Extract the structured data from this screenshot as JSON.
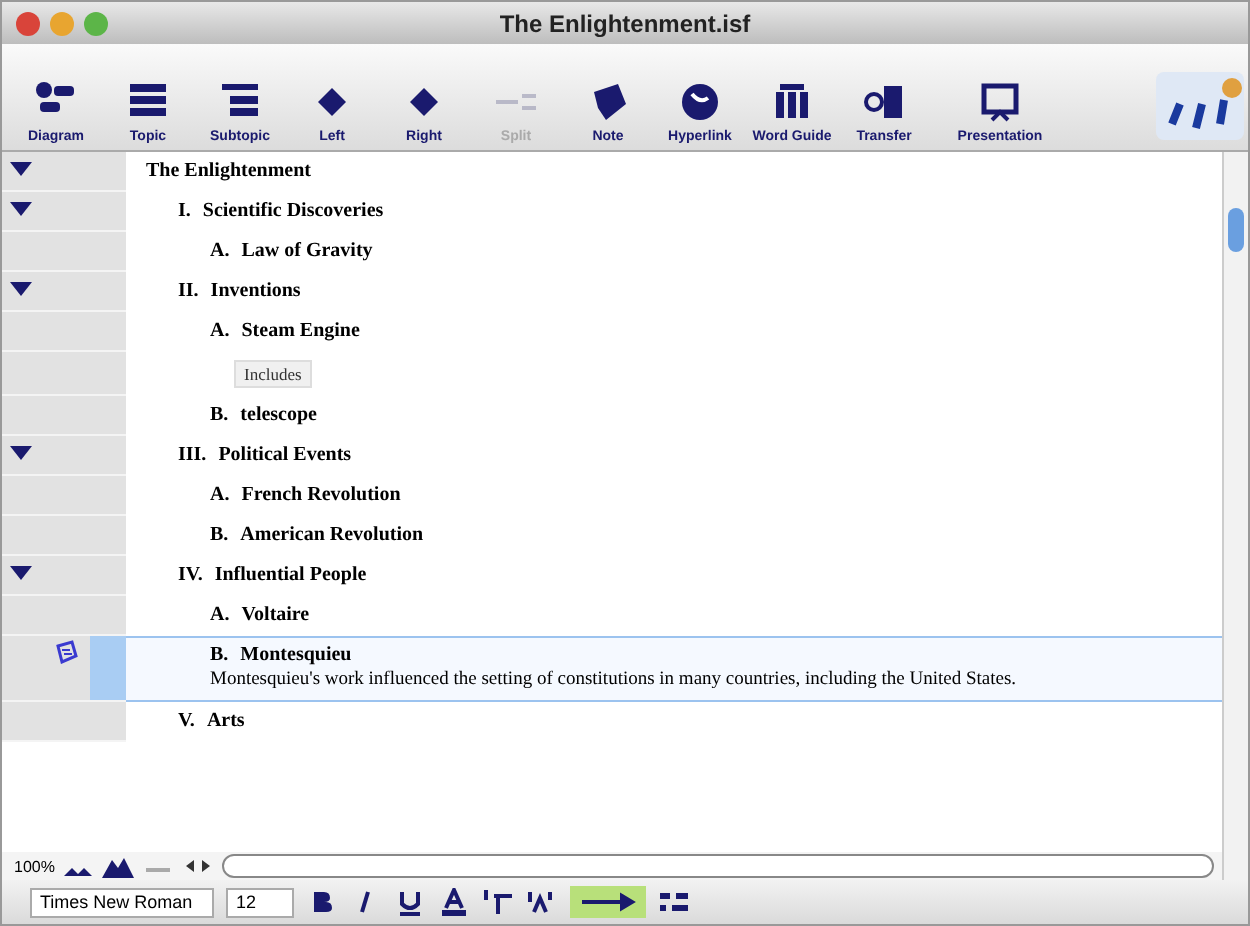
{
  "window": {
    "title": "The Enlightenment.isf"
  },
  "toolbar": [
    {
      "label": "Diagram",
      "disabled": false
    },
    {
      "label": "Topic",
      "disabled": false
    },
    {
      "label": "Subtopic",
      "disabled": false
    },
    {
      "label": "Left",
      "disabled": false
    },
    {
      "label": "Right",
      "disabled": false
    },
    {
      "label": "Split",
      "disabled": true
    },
    {
      "label": "Note",
      "disabled": false
    },
    {
      "label": "Hyperlink",
      "disabled": false
    },
    {
      "label": "Word Guide",
      "disabled": false
    },
    {
      "label": "Transfer",
      "disabled": false
    },
    {
      "label": "Presentation",
      "disabled": false
    }
  ],
  "outline": {
    "kind": "topic",
    "text": "The Enlightenment",
    "expanded": true,
    "selected": false,
    "children": [
      {
        "kind": "topic",
        "label": "I.",
        "text": "Scientific Discoveries",
        "expanded": true,
        "selected": false,
        "children": [
          {
            "kind": "topic",
            "label": "A.",
            "text": "Law of Gravity",
            "selected": false
          }
        ]
      },
      {
        "kind": "topic",
        "label": "II.",
        "text": "Inventions",
        "expanded": true,
        "selected": false,
        "children": [
          {
            "kind": "topic",
            "label": "A.",
            "text": "Steam Engine",
            "selected": false
          },
          {
            "kind": "link",
            "text": "Includes",
            "selected": false
          },
          {
            "kind": "topic",
            "label": "B.",
            "text": "telescope",
            "selected": false
          }
        ]
      },
      {
        "kind": "topic",
        "label": "III.",
        "text": "Political Events",
        "expanded": true,
        "selected": false,
        "children": [
          {
            "kind": "topic",
            "label": "A.",
            "text": "French Revolution",
            "selected": false
          },
          {
            "kind": "topic",
            "label": "B.",
            "text": "American Revolution",
            "selected": false
          }
        ]
      },
      {
        "kind": "topic",
        "label": "IV.",
        "text": "Influential People",
        "expanded": true,
        "selected": false,
        "children": [
          {
            "kind": "topic",
            "label": "A.",
            "text": "Voltaire",
            "selected": false
          },
          {
            "kind": "topic",
            "label": "B.",
            "text": "Montesquieu",
            "selected": true,
            "note": "Montesquieu's work influenced the setting of constitutions in many countries, including the United States."
          }
        ]
      },
      {
        "kind": "topic",
        "label": "V.",
        "text": "Arts",
        "selected": false
      }
    ]
  },
  "zoom": "100%",
  "format": {
    "font": "Times New Roman",
    "size": "12"
  }
}
